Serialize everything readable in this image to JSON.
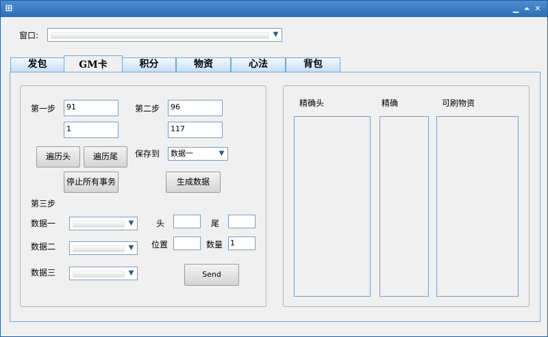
{
  "titlebar": {
    "app_icon": "window-app-icon"
  },
  "window_selector": {
    "label": "窗口:",
    "value": ""
  },
  "tabs": [
    {
      "label": "发包"
    },
    {
      "label": "GM卡"
    },
    {
      "label": "积分"
    },
    {
      "label": "物资"
    },
    {
      "label": "心法"
    },
    {
      "label": "背包"
    }
  ],
  "active_tab": "GM卡",
  "left": {
    "step1": {
      "label": "第一步",
      "value1": "91",
      "value2": "1"
    },
    "step2": {
      "label": "第二步",
      "value1": "96",
      "value2": "117"
    },
    "traverse_head": "遍历头",
    "traverse_tail": "遍历尾",
    "save_to": {
      "label": "保存到",
      "value": "数据一"
    },
    "stop_all": "停止所有事务",
    "generate": "生成数据",
    "step3": {
      "label": "第三步"
    },
    "data1": {
      "label": "数据一",
      "value": ""
    },
    "data2": {
      "label": "数据二",
      "value": ""
    },
    "data3": {
      "label": "数据三",
      "value": ""
    },
    "head": {
      "label": "头",
      "value": ""
    },
    "tail": {
      "label": "尾",
      "value": ""
    },
    "position": {
      "label": "位置",
      "value": ""
    },
    "quantity": {
      "label": "数量",
      "value": "1"
    },
    "send": "Send"
  },
  "right": {
    "col1_header": "精确头",
    "col2_header": "精确",
    "col3_header": "可刷物资"
  }
}
